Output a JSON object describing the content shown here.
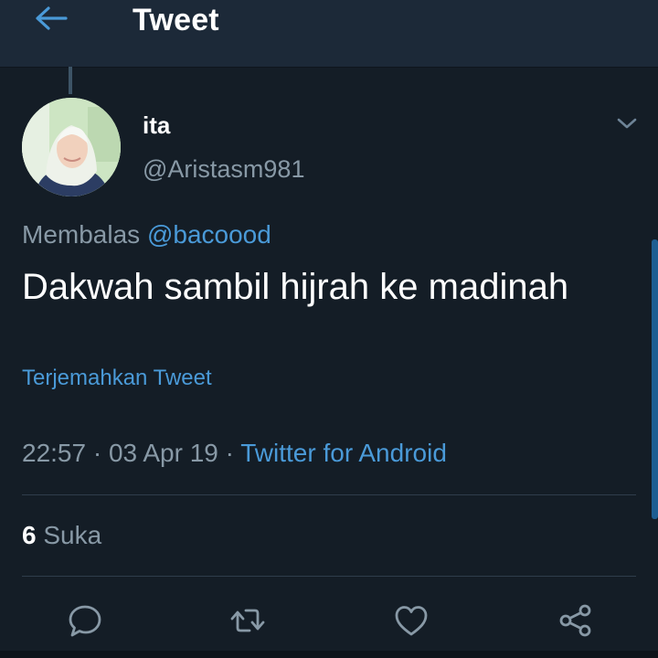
{
  "header": {
    "title": "Tweet",
    "back_icon": "arrow-left-icon"
  },
  "tweet": {
    "author": {
      "name": "ita",
      "username": "@Aristasm981"
    },
    "reply": {
      "prefix": "Membalas",
      "handle": "@bacoood"
    },
    "text": "Dakwah sambil hijrah ke madinah",
    "translate_label": "Terjemahkan Tweet",
    "time": "22:57",
    "date": "03 Apr 19",
    "separator": "·",
    "client": "Twitter for Android",
    "likes": {
      "count": "6",
      "label": "Suka"
    }
  },
  "actions": [
    {
      "name": "reply",
      "icon": "comment-icon"
    },
    {
      "name": "retweet",
      "icon": "retweet-icon"
    },
    {
      "name": "like",
      "icon": "heart-icon"
    },
    {
      "name": "share",
      "icon": "share-icon"
    }
  ],
  "colors": {
    "background": "#141d26",
    "header": "#1c2938",
    "accent": "#4a9ad8",
    "secondary_text": "#8899a6",
    "divider": "#2f3d4b"
  }
}
